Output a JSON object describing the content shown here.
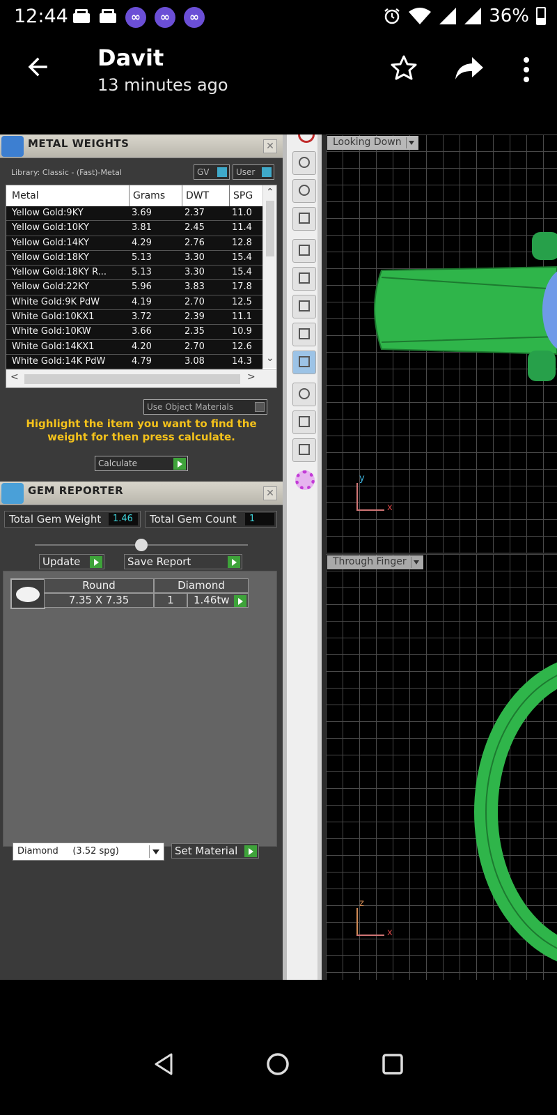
{
  "status_bar": {
    "time": "12:44",
    "battery_text": "36%",
    "icons_left": [
      "mail-icon",
      "mail-icon",
      "infinity-icon",
      "infinity-icon",
      "infinity-icon"
    ],
    "icons_right": [
      "alarm-icon",
      "wifi-icon",
      "signal-icon",
      "signal-icon",
      "battery-icon"
    ]
  },
  "app_bar": {
    "title": "Davit",
    "subtitle": "13 minutes ago",
    "icons": [
      "back-arrow-icon",
      "star-icon",
      "share-icon",
      "more-vert-icon"
    ]
  },
  "metal_weights": {
    "title": "METAL WEIGHTS",
    "library": "Library: Classic - (Fast)-Metal",
    "toggle_gv": "GV",
    "toggle_user": "User",
    "columns": [
      "Metal",
      "Grams",
      "DWT",
      "SPG"
    ],
    "rows": [
      [
        "Yellow Gold:9KY",
        "3.69",
        "2.37",
        "11.0"
      ],
      [
        "Yellow Gold:10KY",
        "3.81",
        "2.45",
        "11.4"
      ],
      [
        "Yellow Gold:14KY",
        "4.29",
        "2.76",
        "12.8"
      ],
      [
        "Yellow Gold:18KY",
        "5.13",
        "3.30",
        "15.4"
      ],
      [
        "Yellow Gold:18KY R...",
        "5.13",
        "3.30",
        "15.4"
      ],
      [
        "Yellow Gold:22KY",
        "5.96",
        "3.83",
        "17.8"
      ],
      [
        "White Gold:9K PdW",
        "4.19",
        "2.70",
        "12.5"
      ],
      [
        "White Gold:10KX1",
        "3.72",
        "2.39",
        "11.1"
      ],
      [
        "White Gold:10KW",
        "3.66",
        "2.35",
        "10.9"
      ],
      [
        "White Gold:14KX1",
        "4.20",
        "2.70",
        "12.6"
      ],
      [
        "White Gold:14K PdW",
        "4.79",
        "3.08",
        "14.3"
      ]
    ],
    "use_object_materials": "Use Object Materials",
    "hint": "Highlight the item you want to find the weight for then press calculate.",
    "calculate": "Calculate"
  },
  "gem_reporter": {
    "title": "GEM REPORTER",
    "total_weight_label": "Total Gem Weight",
    "total_weight_value": "1.46",
    "total_count_label": "Total Gem Count",
    "total_count_value": "1",
    "update": "Update",
    "save_report": "Save Report",
    "gem": {
      "shape": "Round",
      "size": "7.35 X 7.35",
      "material": "Diamond",
      "count": "1",
      "weight": "1.46tw"
    },
    "material_select": "Diamond     (3.52 spg)",
    "set_material": "Set Material"
  },
  "viewports": {
    "top_label": "Looking Down",
    "bottom_label": "Through Finger",
    "top_axes": [
      "y",
      "x"
    ],
    "bottom_axes": [
      "z",
      "x"
    ]
  },
  "colors": {
    "accent_gold": "#f4c21b",
    "model_green": "#2fb54a",
    "gem_blue": "#6f9ae8",
    "value_cyan": "#3fd1d8"
  },
  "nav_bar": {
    "icons": [
      "back-triangle-icon",
      "home-circle-icon",
      "recents-square-icon"
    ]
  }
}
